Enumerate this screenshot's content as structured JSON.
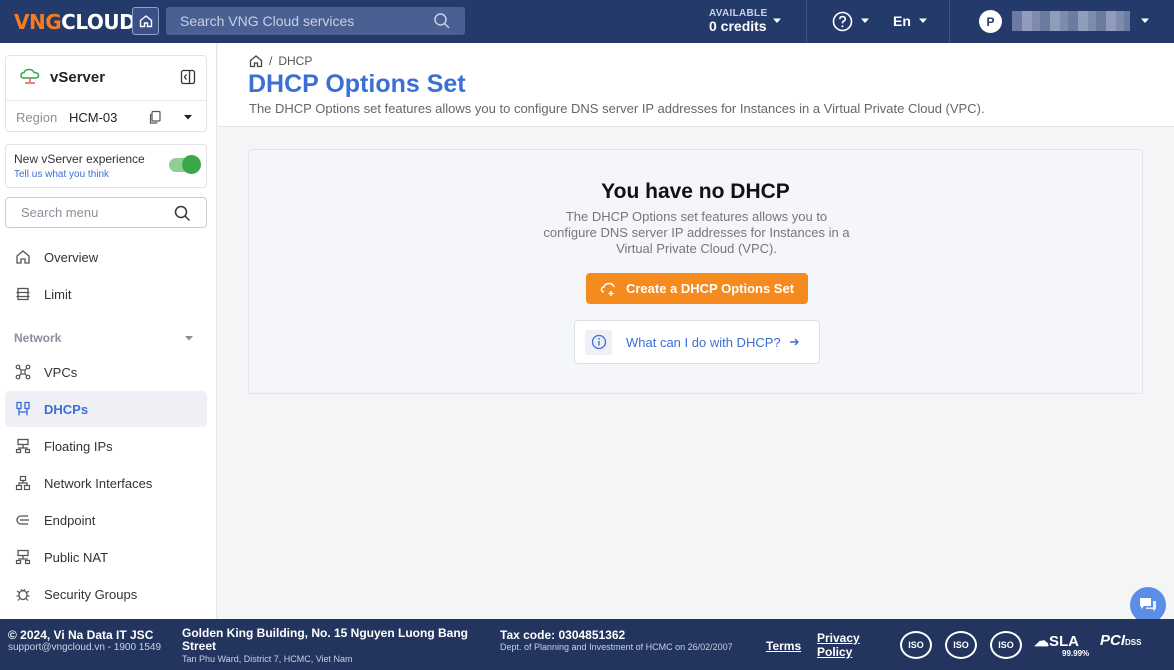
{
  "topbar": {
    "logo_vng": "VNG",
    "logo_cloud": "CLOUD",
    "search_placeholder": "Search VNG Cloud services",
    "credits_label": "AVAILABLE",
    "credits_value": "0 credits",
    "language": "En",
    "avatar_initial": "P"
  },
  "sidebar": {
    "service_name": "vServer",
    "region_label": "Region",
    "region_value": "HCM-03",
    "experience_title": "New vServer experience",
    "experience_link": "Tell us what you think",
    "search_placeholder": "Search menu",
    "section_network": "Network",
    "items": [
      {
        "label": "Overview",
        "icon": "home-icon"
      },
      {
        "label": "Limit",
        "icon": "limit-icon"
      },
      {
        "label": "VPCs",
        "icon": "vpc-icon"
      },
      {
        "label": "DHCPs",
        "icon": "dhcp-icon"
      },
      {
        "label": "Floating IPs",
        "icon": "floating-ip-icon"
      },
      {
        "label": "Network Interfaces",
        "icon": "network-interface-icon"
      },
      {
        "label": "Endpoint",
        "icon": "endpoint-icon"
      },
      {
        "label": "Public NAT",
        "icon": "nat-icon"
      },
      {
        "label": "Security Groups",
        "icon": "security-group-icon"
      }
    ]
  },
  "main": {
    "breadcrumb": "DHCP",
    "title": "DHCP Options Set",
    "description": "The DHCP Options set features allows you to configure DNS server IP addresses for Instances in a Virtual Private Cloud (VPC).",
    "empty_title": "You have no DHCP",
    "empty_desc": "The DHCP Options set features allows you to configure DNS server IP addresses for Instances in a Virtual Private Cloud (VPC).",
    "create_label": "Create a DHCP Options Set",
    "help_label": "What can I do with DHCP?"
  },
  "footer": {
    "copyright": "© 2024, Vi Na Data IT JSC",
    "support": "support@vngcloud.vn - 1900 1549",
    "address": "Golden King Building, No. 15 Nguyen Luong Bang Street",
    "address_sub": "Tan Phu Ward, District 7, HCMC, Viet Nam",
    "tax_label": "Tax code:",
    "tax_value": "0304851362",
    "tax_sub": "Dept. of Planning and Investment of HCMC on 26/02/2007",
    "terms": "Terms",
    "privacy": "Privacy Policy",
    "iso": "ISO",
    "sla": "SLA",
    "sla_value": "99.99%",
    "pci": "PCI",
    "pci_dss": "DSS"
  },
  "colors": {
    "topbar": "#243a6b",
    "accent": "#3b6fd6",
    "create_button": "#f58a1f",
    "toggle_on": "#3aa84a"
  }
}
